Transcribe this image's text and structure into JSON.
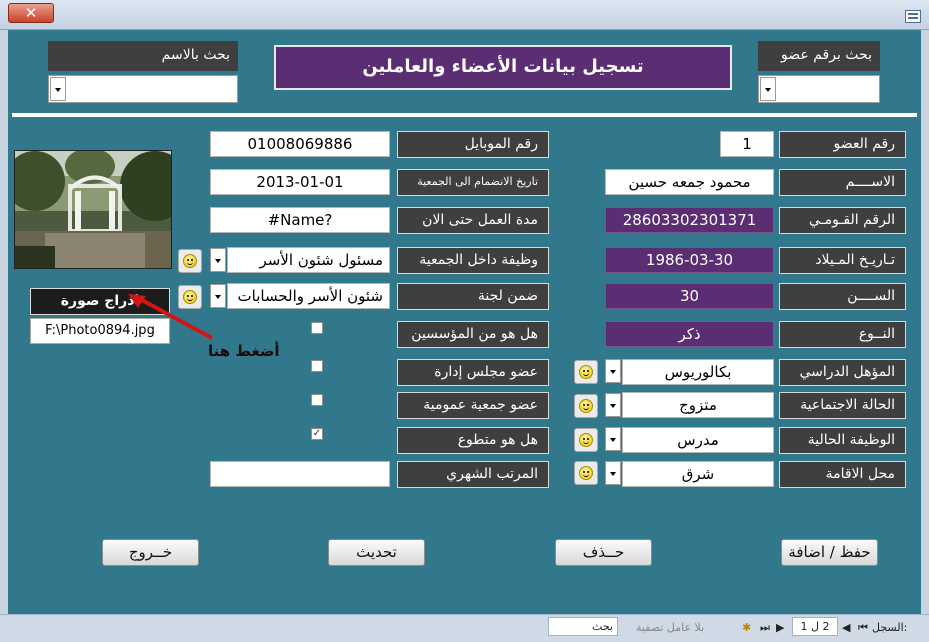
{
  "window": {
    "close_label": "✕"
  },
  "search": {
    "by_name_label": "بحث بالاسم",
    "by_member_label": "بحث برقم عضو"
  },
  "title": "تسجيل بيانات الأعضاء والعاملين",
  "left_fields": {
    "mobile_label": "رقم الموبايل",
    "mobile_value": "01008069886",
    "join_date_label": "تاريخ الانضمام الى الجمعية",
    "join_date_value": "2013-01-01",
    "work_duration_label": "مدة العمل حتى الان",
    "work_duration_value": "#Name?",
    "internal_job_label": "وظيفة داخل الجمعية",
    "internal_job_value": "مسئول شئون الأسر",
    "committee_label": "ضمن لجنة",
    "committee_value": "شئون الأسر والحسابات",
    "founder_label": "هل هو من المؤسسين",
    "board_label": "عضو مجلس إدارة",
    "general_assembly_label": "عضو جمعية عمومية",
    "volunteer_label": "هل هو متطوع",
    "salary_label": "المرتب الشهري",
    "salary_value": ""
  },
  "checkboxes": {
    "founder": "",
    "board": "",
    "general_assembly": "",
    "volunteer": "✓"
  },
  "right_fields": {
    "member_no_label": "رقم العضو",
    "member_no_value": "1",
    "name_label": "الاســــم",
    "name_value": "محمود جمعه حسين",
    "national_id_label": "الرقم القـومـي",
    "national_id_value": "28603302301371",
    "birth_date_label": "تـاريـخ المـيلاد",
    "birth_date_value": "1986-03-30",
    "age_label": "الســــن",
    "age_value": "30",
    "gender_label": "النــوع",
    "gender_value": "ذكر",
    "qualification_label": "المؤهل الدراسي",
    "qualification_value": "بكالوريوس",
    "marital_label": "الحالة الاجتماعية",
    "marital_value": "متزوج",
    "current_job_label": "الوظيفة الحالية",
    "current_job_value": "مدرس",
    "residence_label": "محل الاقامة",
    "residence_value": "شرق"
  },
  "photo": {
    "insert_label": "ادراج صورة",
    "file_path": "F:\\Photo0894.jpg",
    "annotation": "أضغط هنا"
  },
  "buttons": {
    "save": "حفظ / اضافة",
    "delete": "حــذف",
    "update": "تحديث",
    "exit": "خــروج"
  },
  "statusbar": {
    "record_label": "السجل:",
    "record_value": "2 ل 1",
    "no_filter": "بلا عامل تصفية",
    "search": "بحث"
  },
  "colors": {
    "form_bg": "#31788c",
    "label_bg": "#3f3f3f",
    "accent_purple": "#5b2d73"
  }
}
